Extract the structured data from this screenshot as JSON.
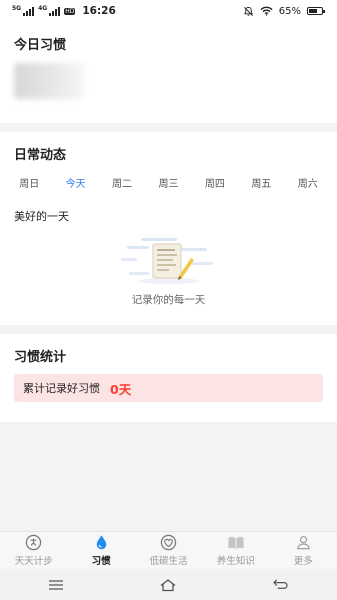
{
  "status_bar": {
    "network_1": "5G",
    "network_2": "4G",
    "hd": "HD",
    "time": "16:26",
    "battery_percent": "65%",
    "battery_level": 0.65
  },
  "today_habits": {
    "title": "今日习惯"
  },
  "daily_activity": {
    "title": "日常动态",
    "weekdays": [
      {
        "label": "周日"
      },
      {
        "label": "今天"
      },
      {
        "label": "周二"
      },
      {
        "label": "周三"
      },
      {
        "label": "周四"
      },
      {
        "label": "周五"
      },
      {
        "label": "周六"
      }
    ],
    "active_index": 1,
    "day_label": "美好的一天",
    "empty_text": "记录你的每一天"
  },
  "habit_stats": {
    "title": "习惯统计",
    "label": "累计记录好习惯",
    "value": "0天"
  },
  "tabbar": {
    "items": [
      {
        "label": "天天计步",
        "icon": "step-icon"
      },
      {
        "label": "习惯",
        "icon": "drop-icon"
      },
      {
        "label": "低碳生活",
        "icon": "heart-icon"
      },
      {
        "label": "养生知识",
        "icon": "book-icon"
      },
      {
        "label": "更多",
        "icon": "user-icon"
      }
    ],
    "active_index": 1
  },
  "colors": {
    "accent": "#2f7df6",
    "stat_value": "#ff3b30",
    "stat_bg": "#fde4e4",
    "active_tab_icon": "#1e8cf0",
    "inactive": "#999999"
  }
}
